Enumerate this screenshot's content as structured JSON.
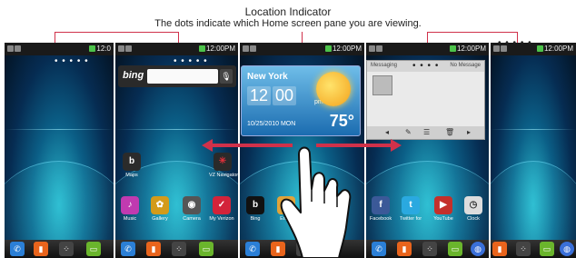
{
  "caption": {
    "title": "Location Indicator",
    "subtitle": "The dots indicate which Home screen pane you are viewing."
  },
  "status_time": "12:00PM",
  "status_time_partial": "12:0",
  "bing": {
    "logo": "bing",
    "mic_icon": "microphone-icon"
  },
  "weather": {
    "city": "New York",
    "hour": "12",
    "minute": "00",
    "ampm": "pm",
    "date": "10/25/2010 MON",
    "temperature": "75°"
  },
  "messaging": {
    "title": "Messaging",
    "status": "No Message"
  },
  "apps_pane2_top": [
    {
      "label": "Maps",
      "icon": "maps-icon",
      "color": "#2b2b2b",
      "glyph": "b"
    },
    {
      "label": "VZ Navigator",
      "icon": "navigator-icon",
      "color": "#2a2a2a",
      "glyph": "✳"
    }
  ],
  "apps_row": [
    {
      "label": "Music",
      "icon": "music-icon",
      "color": "#c03ab0",
      "glyph": "♪"
    },
    {
      "label": "Gallery",
      "icon": "gallery-icon",
      "color": "#d39b1a",
      "glyph": "✿"
    },
    {
      "label": "Camera",
      "icon": "camera-icon",
      "color": "#555",
      "glyph": "◉"
    },
    {
      "label": "My Verizon",
      "icon": "my-verizon-icon",
      "color": "#d3233a",
      "glyph": "✓"
    },
    {
      "label": "Bing",
      "icon": "bing-icon",
      "color": "#111",
      "glyph": "b"
    },
    {
      "label": "Email",
      "icon": "email-icon",
      "color": "#e0a33a",
      "glyph": "✉"
    },
    {
      "label": "Facebook",
      "icon": "facebook-icon",
      "color": "#3b5998",
      "glyph": "f"
    },
    {
      "label": "Twitter for",
      "icon": "twitter-icon",
      "color": "#2aa9e0",
      "glyph": "t"
    },
    {
      "label": "YouTube",
      "icon": "youtube-icon",
      "color": "#c4302b",
      "glyph": "▶"
    },
    {
      "label": "Clock",
      "icon": "clock-icon",
      "color": "#ddd",
      "glyph": "◷"
    }
  ]
}
